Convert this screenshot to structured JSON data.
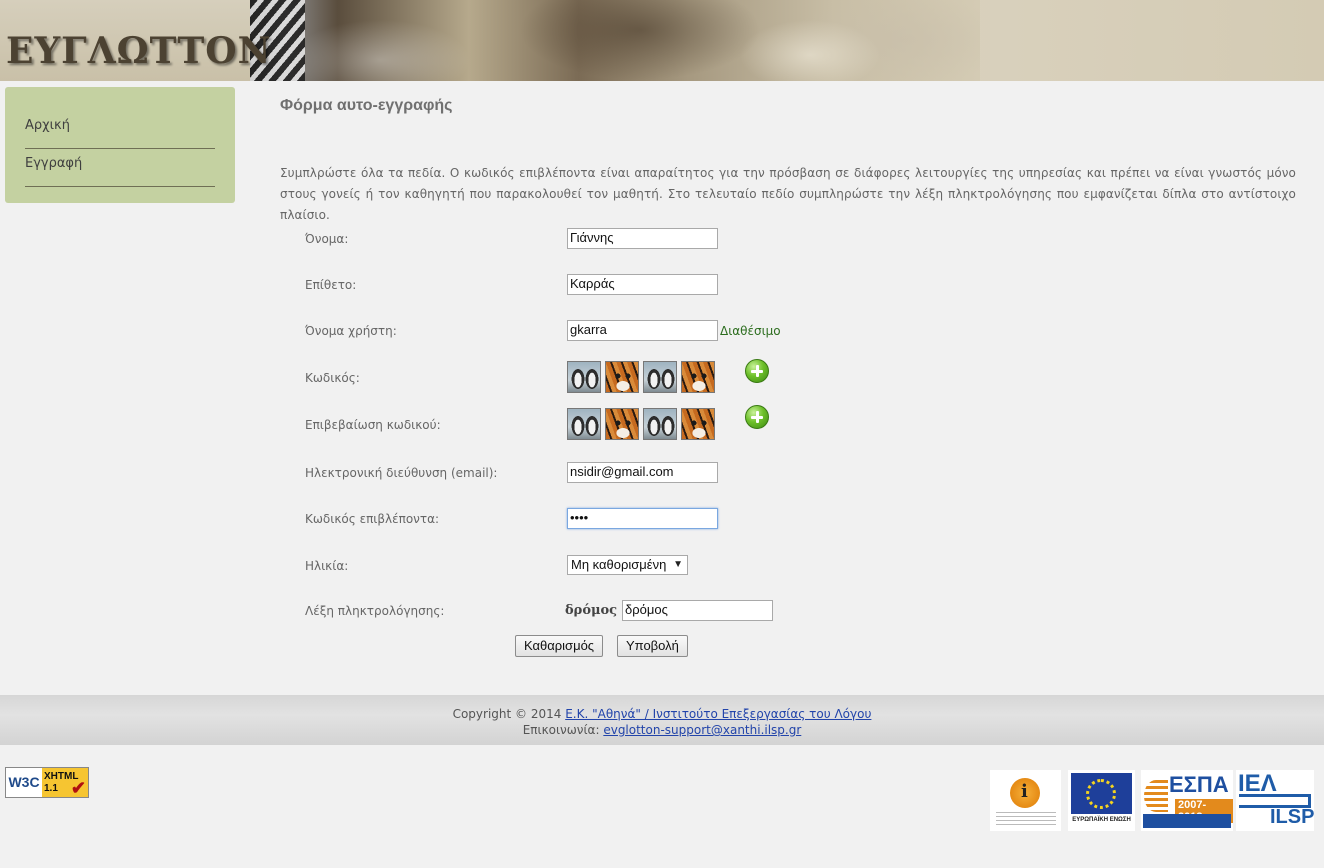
{
  "header": {
    "logo_text": "ΕΥΓΛΩΤΤΟΝ"
  },
  "sidebar": {
    "items": [
      {
        "label": "Αρχική"
      },
      {
        "label": "Εγγραφή"
      }
    ]
  },
  "main": {
    "title": "Φόρμα αυτο-εγγραφής",
    "intro": "Συμπλρώστε όλα τα πεδία. Ο κωδικός επιβλέποντα είναι απαραίτητος για την πρόσβαση σε διάφορες λειτουργίες της υπηρεσίας και πρέπει να είναι γνωστός μόνο στους γονείς ή τον καθηγητή που παρακολουθεί τον μαθητή. Στο τελευταίο πεδίο συμπληρώστε την λέξη πληκτρολόγησης που εμφανίζεται δίπλα στο αντίστοιχο πλαίσιο."
  },
  "form": {
    "first_name": {
      "label": "Όνομα:",
      "value": "Γιάννης"
    },
    "last_name": {
      "label": "Επίθετο:",
      "value": "Καρράς"
    },
    "username": {
      "label": "Όνομα χρήστη:",
      "value": "gkarra",
      "status": "Διαθέσιμο"
    },
    "password": {
      "label": "Κωδικός:",
      "pictures": [
        "penguin",
        "tiger",
        "penguin",
        "tiger"
      ]
    },
    "password_confirm": {
      "label": "Επιβεβαίωση κωδικού:",
      "pictures": [
        "penguin",
        "tiger",
        "penguin",
        "tiger"
      ]
    },
    "email": {
      "label": "Ηλεκτρονική διεύθυνση (email):",
      "value": "nsidir@gmail.com"
    },
    "supervisor_code": {
      "label": "Κωδικός επιβλέποντα:",
      "value": "••••"
    },
    "age": {
      "label": "Ηλικία:",
      "selected": "Μη καθορισμένη"
    },
    "captcha": {
      "label": "Λέξη πληκτρολόγησης:",
      "word": "δρόμος",
      "value": "δρόμος"
    },
    "reset_label": "Καθαρισμός",
    "submit_label": "Υποβολή"
  },
  "footer": {
    "copyright_prefix": "Copyright © 2014 ",
    "copyright_link": "Ε.Κ. \"Αθηνά\" / Ινστιτούτο Επεξεργασίας του Λόγου",
    "contact_prefix": "Επικοινωνία: ",
    "contact_email": "evglotton-support@xanthi.ilsp.gr"
  },
  "badges": {
    "w3c_left": "W3C",
    "w3c_right_1": "XHTML",
    "w3c_right_2": "1.1",
    "eu_caption": "ΕΥΡΩΠΑΪΚΗ ΕΝΩΣΗ",
    "espa_title": "ΕΣΠΑ",
    "espa_years": "2007-2013",
    "iel_top": "ΙΕΛ",
    "iel_bottom": "ILSP"
  }
}
